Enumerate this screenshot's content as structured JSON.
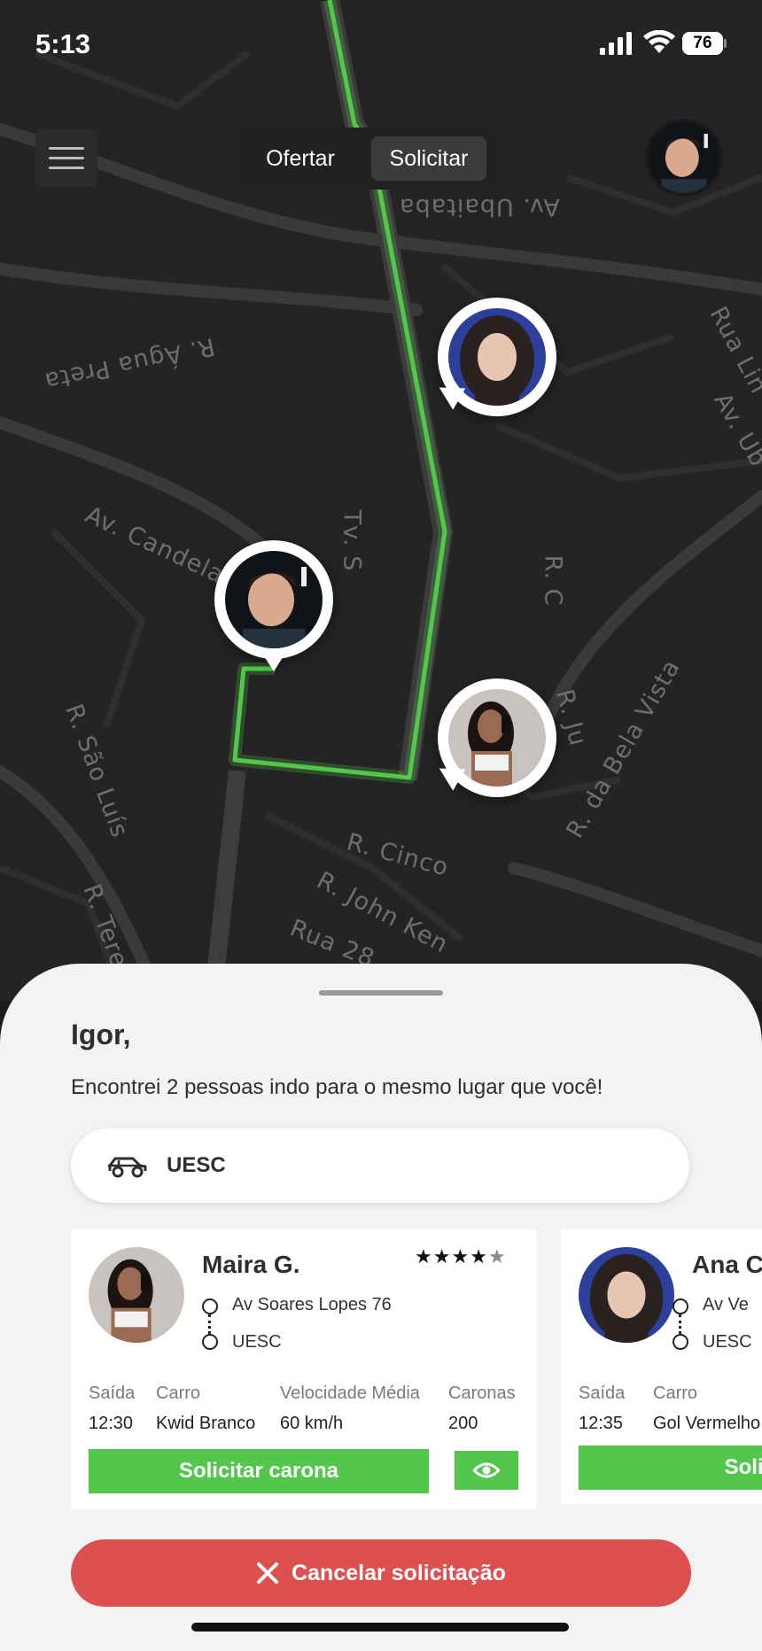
{
  "status_bar": {
    "time": "5:13",
    "battery": "76"
  },
  "top_bar": {
    "tabs": [
      "Ofertar",
      "Solicitar"
    ],
    "active_tab": "Solicitar"
  },
  "map": {
    "streets": [
      "Av. Ubaitaba",
      "R. Água Preta",
      "Rua Lin",
      "Av. Ub",
      "Av. Candela",
      "Tv. S",
      "R. C",
      "R. da Bela Vista",
      "R. Ju",
      "R. São Luís",
      "R. Tere",
      "R. Cinco",
      "R. John Ken",
      "Rua 28"
    ],
    "route_color": "#52c74c"
  },
  "sheet": {
    "greeting": "Igor,",
    "message": "Encontrei 2 pessoas indo para o mesmo lugar que você!",
    "destination": {
      "icon": "car-icon",
      "label": "UESC"
    },
    "cards": [
      {
        "name": "Maira G.",
        "rating": 4,
        "rating_max": 5,
        "origin": "Av Soares Lopes 76",
        "destination": "UESC",
        "headers": {
          "departure": "Saída",
          "car": "Carro",
          "speed": "Velocidade Média",
          "rides": "Caronas"
        },
        "departure": "12:30",
        "car": "Kwid Branco",
        "speed": "60 km/h",
        "rides": "200",
        "request_label": "Solicitar carona"
      },
      {
        "name": "Ana C",
        "origin": "Av Ve",
        "destination": "UESC",
        "headers": {
          "departure": "Saída",
          "car": "Carro"
        },
        "departure": "12:35",
        "car": "Gol Vermelho",
        "request_label": "Solicita"
      }
    ],
    "cancel_label": "Cancelar solicitação"
  },
  "colors": {
    "accent_green": "#52c74c",
    "cancel_red": "#dd5050",
    "map_bg": "#242424",
    "sheet_bg": "#f3f3f3"
  }
}
